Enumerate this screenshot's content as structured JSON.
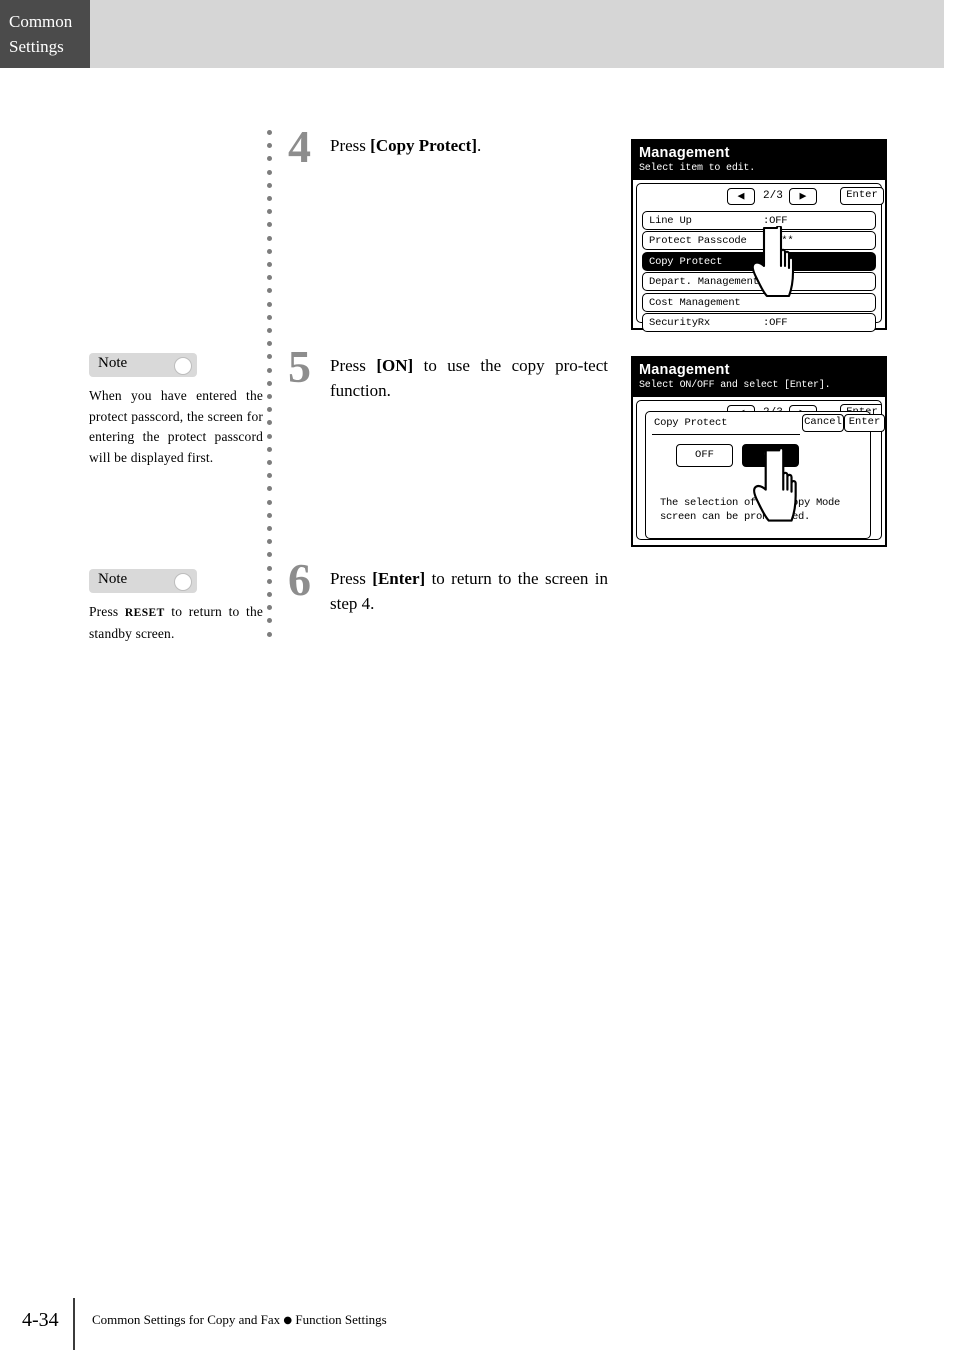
{
  "header": {
    "tab_line1": "Common",
    "tab_line2": "Settings"
  },
  "steps": [
    {
      "number": "4",
      "text_pre": "Press ",
      "text_bold": "[Copy Protect]",
      "text_post": "."
    },
    {
      "number": "5",
      "text_pre": "Press ",
      "text_bold": "[ON]",
      "text_post": " to use the copy pro‑tect function."
    },
    {
      "number": "6",
      "text_pre": "Press ",
      "text_bold": "[Enter]",
      "text_post": " to return to the screen in step 4."
    }
  ],
  "notes": [
    {
      "label": "Note",
      "body_pre": "When you have entered the protect passcord, the screen for entering the protect passcord will be displayed first.",
      "keyword": "",
      "body_post": ""
    },
    {
      "label": "Note",
      "body_pre": "Press ",
      "keyword": "RESET",
      "body_post": " to return to the standby screen."
    }
  ],
  "lcd_screens": [
    {
      "title": "Management",
      "subtitle": "Select item to edit.",
      "nav": {
        "prev_icon": "left-arrow-icon",
        "prev_glyph": "◀",
        "page_indicator": "2/3",
        "next_icon": "right-arrow-icon",
        "next_glyph": "▶",
        "enter_label": "Enter"
      },
      "rows": [
        {
          "label": "Line Up",
          "value": ":OFF",
          "selected": false
        },
        {
          "label": "Protect Passcode",
          "value": ":****",
          "selected": false
        },
        {
          "label": "Copy Protect",
          "value": ":OFF",
          "selected": true
        },
        {
          "label": "Depart. Management",
          "value": "",
          "selected": false
        },
        {
          "label": "Cost Management",
          "value": "",
          "selected": false
        },
        {
          "label": "SecurityRx",
          "value": ":OFF",
          "selected": false
        }
      ],
      "pointer_icon": "hand-pointer-icon"
    },
    {
      "title": "Management",
      "subtitle": "Select ON/OFF and select [Enter].",
      "background_nav": {
        "prev_glyph": "◀",
        "page_indicator": "2/3",
        "next_glyph": "▶",
        "enter_label": "Enter"
      },
      "dialog": {
        "title": "Copy Protect",
        "cancel_label": "Cancel",
        "enter_label": "Enter",
        "toggle_off_label": "OFF",
        "toggle_on_label": "ON",
        "toggle_selected": "ON",
        "description": "The selection of the Copy Mode screen can be prohibited."
      },
      "pointer_icon": "hand-pointer-icon"
    }
  ],
  "footer": {
    "page_number": "4-34",
    "text_left": "Common Settings for Copy and Fax",
    "bullet": "●",
    "text_right": "Function Settings"
  },
  "colors": {
    "header_band": "#d6d6d6",
    "header_tab": "#4b4b4b",
    "step_number": "#8d8d8d",
    "note_bar": "#d9d9d9",
    "dot_divider": "#7d7d7d",
    "lcd_selected": "#000000"
  }
}
